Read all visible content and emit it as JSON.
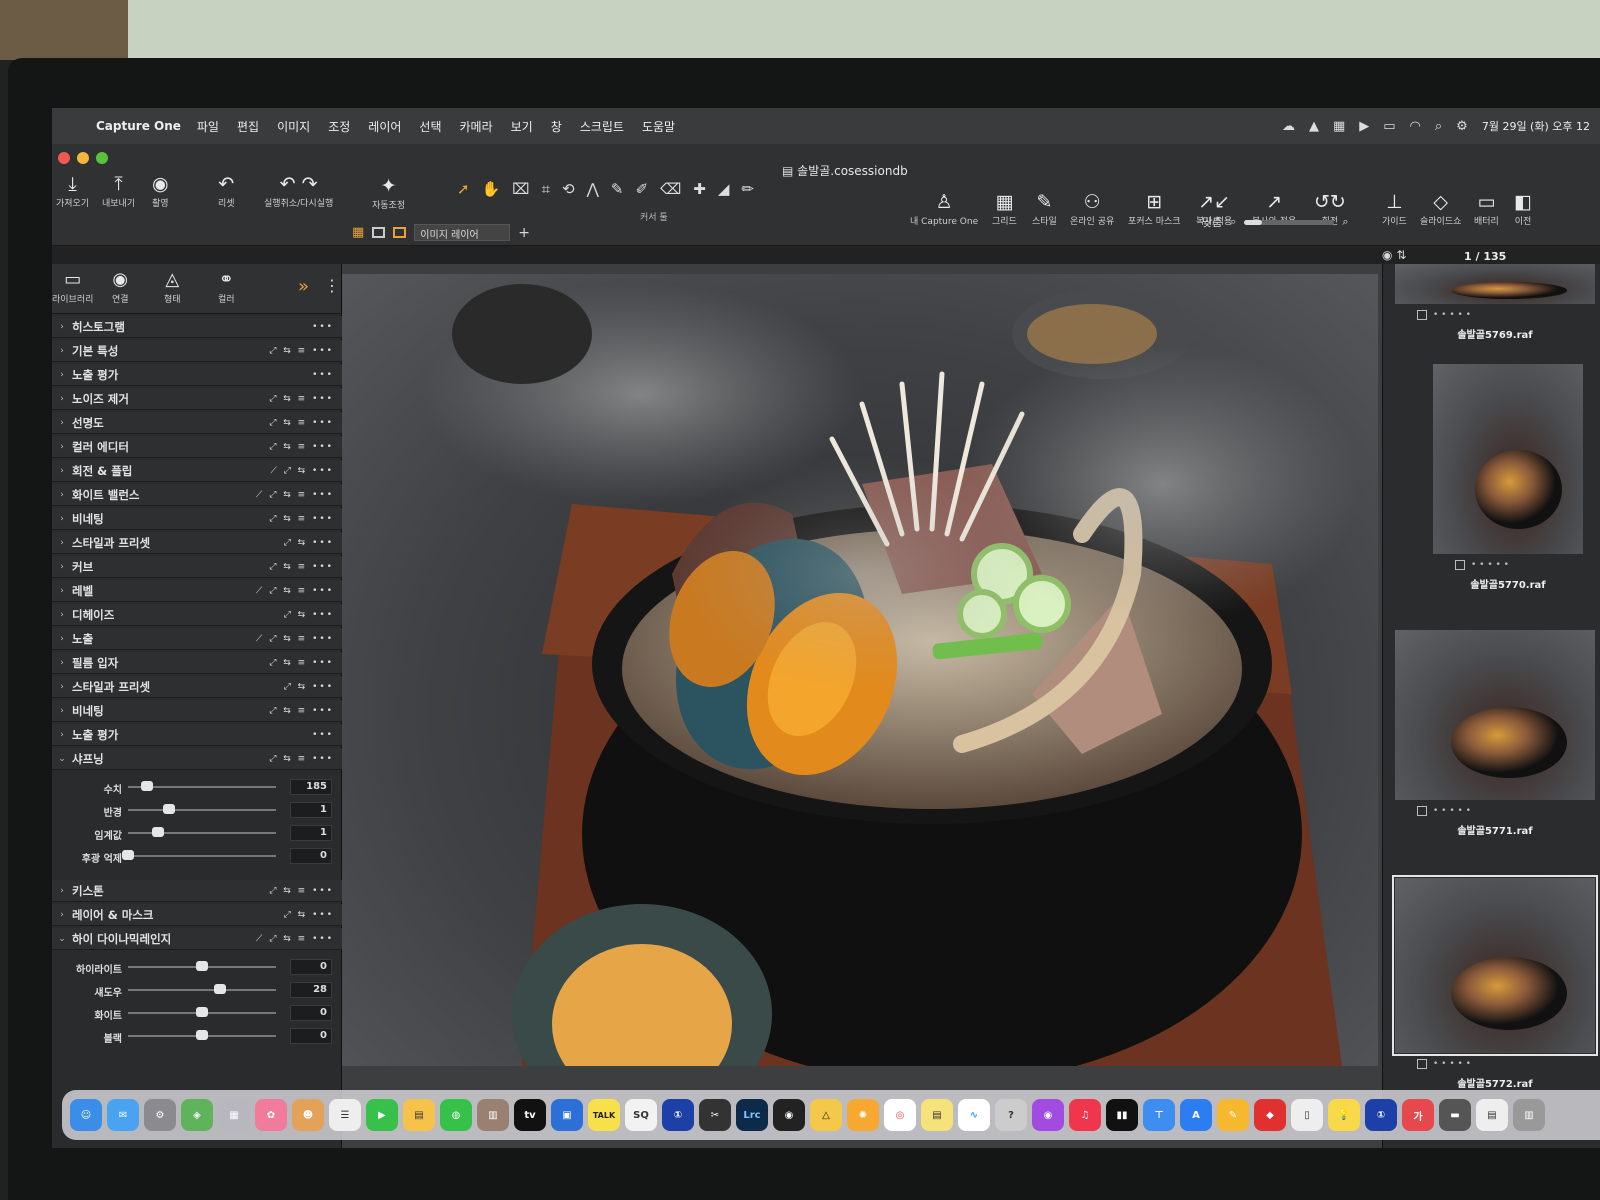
{
  "menubar": {
    "app": "Capture One",
    "items": [
      "파일",
      "편집",
      "이미지",
      "조정",
      "레이어",
      "선택",
      "카메라",
      "보기",
      "창",
      "스크립트",
      "도움말"
    ],
    "clock": "7월 29일 (화) 오후 12"
  },
  "window": {
    "title": "솔발골.cosessiondb"
  },
  "toolbar": {
    "import": "가져오기",
    "export": "내보내기",
    "capture": "촬영",
    "reset": "리셋",
    "undo_redo": "실행취소/다시실행",
    "auto_adjust": "자동조정",
    "cursor_tools": "커서 툴",
    "my_capture_one": "내 Capture One",
    "grid": "그리드",
    "style": "스타일",
    "online_share": "온라인 공유",
    "focus_mask": "포커스 마스크",
    "copy_apply": "복사/적용",
    "copy_and_apply": "복사와 적용",
    "rotate": "회전",
    "guide": "가이드",
    "slideshow": "슬라이드쇼",
    "battery": "배터리",
    "before": "이전"
  },
  "tool_tabs": [
    "라이브러리",
    "연결",
    "형태",
    "컬러"
  ],
  "layer_select": "이미지 레이어",
  "view": {
    "fit": "맞춤",
    "page": "1 / 135"
  },
  "panels_top": [
    {
      "label": "히스토그램",
      "acts": "•••"
    },
    {
      "label": "기본 특성",
      "acts": "⤢ ⇆ ≡ •••"
    },
    {
      "label": "노출 평가",
      "acts": "•••"
    },
    {
      "label": "노이즈 제거",
      "acts": "⤢ ⇆ ≡ •••"
    },
    {
      "label": "선명도",
      "acts": "⤢ ⇆ ≡ •••"
    },
    {
      "label": "컬러 에디터",
      "acts": "⤢ ⇆ ≡ •••"
    },
    {
      "label": "회전 & 플립",
      "acts": "⟋ ⤢ ⇆ •••"
    },
    {
      "label": "화이트 밸런스",
      "acts": "⟋ ⤢ ⇆ ≡ •••"
    },
    {
      "label": "비네팅",
      "acts": "⤢ ⇆ ≡ •••"
    },
    {
      "label": "스타일과 프리셋",
      "acts": "⤢ ⇆ •••"
    },
    {
      "label": "커브",
      "acts": "⤢ ⇆ ≡ •••"
    },
    {
      "label": "레벨",
      "acts": "⟋ ⤢ ⇆ ≡ •••"
    },
    {
      "label": "디헤이즈",
      "acts": "⤢ ⇆ •••"
    },
    {
      "label": "노출",
      "acts": "⟋ ⤢ ⇆ ≡ •••"
    },
    {
      "label": "필름 입자",
      "acts": "⤢ ⇆ ≡ •••"
    },
    {
      "label": "스타일과 프리셋",
      "acts": "⤢ ⇆ •••"
    },
    {
      "label": "비네팅",
      "acts": "⤢ ⇆ ≡ •••"
    },
    {
      "label": "노출 평가",
      "acts": "•••"
    }
  ],
  "sharpening": {
    "label": "샤프닝",
    "acts": "⤢ ⇆ ≡ •••",
    "sliders": [
      {
        "label": "수치",
        "value": "185",
        "level": 0.13
      },
      {
        "label": "반경",
        "value": "1",
        "level": 0.28
      },
      {
        "label": "임계값",
        "value": "1",
        "level": 0.2
      },
      {
        "label": "후광 억제",
        "value": "0",
        "level": 0.0
      }
    ]
  },
  "panels_mid": [
    {
      "label": "키스톤",
      "acts": "⤢ ⇆ ≡ •••"
    },
    {
      "label": "레이어 & 마스크",
      "acts": "⤢ ⇆ •••"
    }
  ],
  "hdr": {
    "label": "하이 다이나믹레인지",
    "acts": "⟋ ⤢ ⇆ ≡ •••",
    "sliders": [
      {
        "label": "하이라이트",
        "value": "0",
        "level": 0.5
      },
      {
        "label": "섀도우",
        "value": "28",
        "level": 0.62
      },
      {
        "label": "화이트",
        "value": "0",
        "level": 0.5
      },
      {
        "label": "블랙",
        "value": "0",
        "level": 0.5
      }
    ]
  },
  "thumbnails": [
    {
      "name": "솔발골5769.raf"
    },
    {
      "name": "솔발골5770.raf"
    },
    {
      "name": "솔발골5771.raf"
    },
    {
      "name": "솔발골5772.raf"
    }
  ],
  "dock": [
    "tv",
    "Lrc",
    "TALK",
    "SQ",
    "가"
  ],
  "colors": {
    "accent": "#e8a23a",
    "panel": "#2e2f30"
  }
}
